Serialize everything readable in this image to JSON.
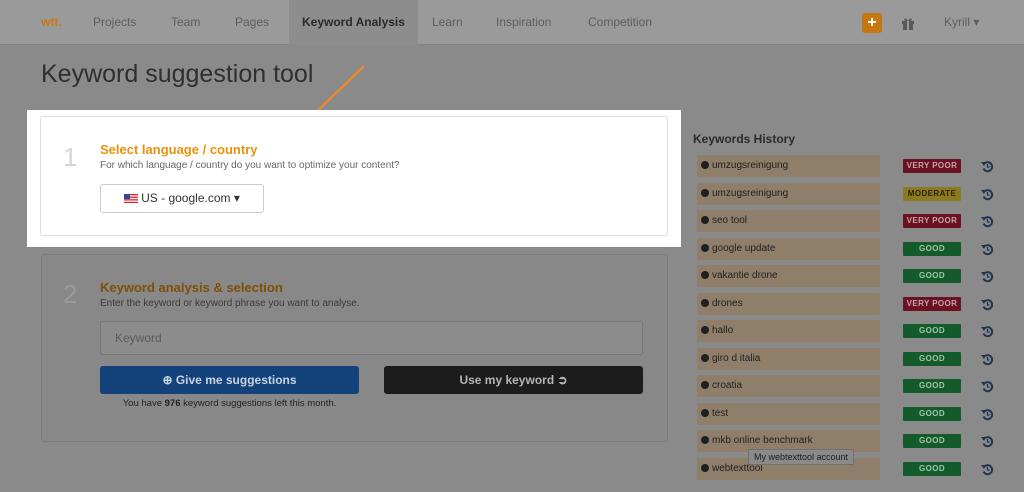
{
  "nav": {
    "logo": "wtt.",
    "items": [
      "Projects",
      "Team",
      "Pages",
      "Keyword Analysis",
      "Learn",
      "Inspiration",
      "Competition"
    ],
    "active": "Keyword Analysis",
    "add_label": "+",
    "user": "Kyrill ▾"
  },
  "page": {
    "title": "Keyword suggestion tool"
  },
  "step1": {
    "number": "1",
    "title": "Select language / country",
    "subtitle": "For which language / country do you want to optimize your content?",
    "selected": "US - google.com ▾"
  },
  "step2": {
    "number": "2",
    "title": "Keyword analysis & selection",
    "subtitle": "Enter the keyword or keyword phrase you want to analyse.",
    "placeholder": "Keyword",
    "suggest_label": "⊕ Give me suggestions",
    "use_label": "Use my keyword ➲",
    "quota_prefix": "You have ",
    "quota_count": "976",
    "quota_suffix": " keyword suggestions left this month."
  },
  "history": {
    "title": "Keywords History",
    "items": [
      {
        "keyword": "umzugsreinigung",
        "rating": "VERY POOR"
      },
      {
        "keyword": "umzugsreinigung",
        "rating": "MODERATE"
      },
      {
        "keyword": "seo tool",
        "rating": "VERY POOR"
      },
      {
        "keyword": "google update",
        "rating": "GOOD"
      },
      {
        "keyword": "vakantie drone",
        "rating": "GOOD"
      },
      {
        "keyword": "drones",
        "rating": "VERY POOR"
      },
      {
        "keyword": "hallo",
        "rating": "GOOD"
      },
      {
        "keyword": "giro d italia",
        "rating": "GOOD"
      },
      {
        "keyword": "croatia",
        "rating": "GOOD"
      },
      {
        "keyword": "test",
        "rating": "GOOD"
      },
      {
        "keyword": "mkb online benchmark",
        "rating": "GOOD"
      },
      {
        "keyword": "webtexttool",
        "rating": "GOOD"
      }
    ]
  },
  "tooltip": "My webtexttool account",
  "colors": {
    "accent": "#e8920c",
    "very_poor": "#c0243f",
    "moderate": "#f2d33a",
    "good": "#239b46"
  }
}
